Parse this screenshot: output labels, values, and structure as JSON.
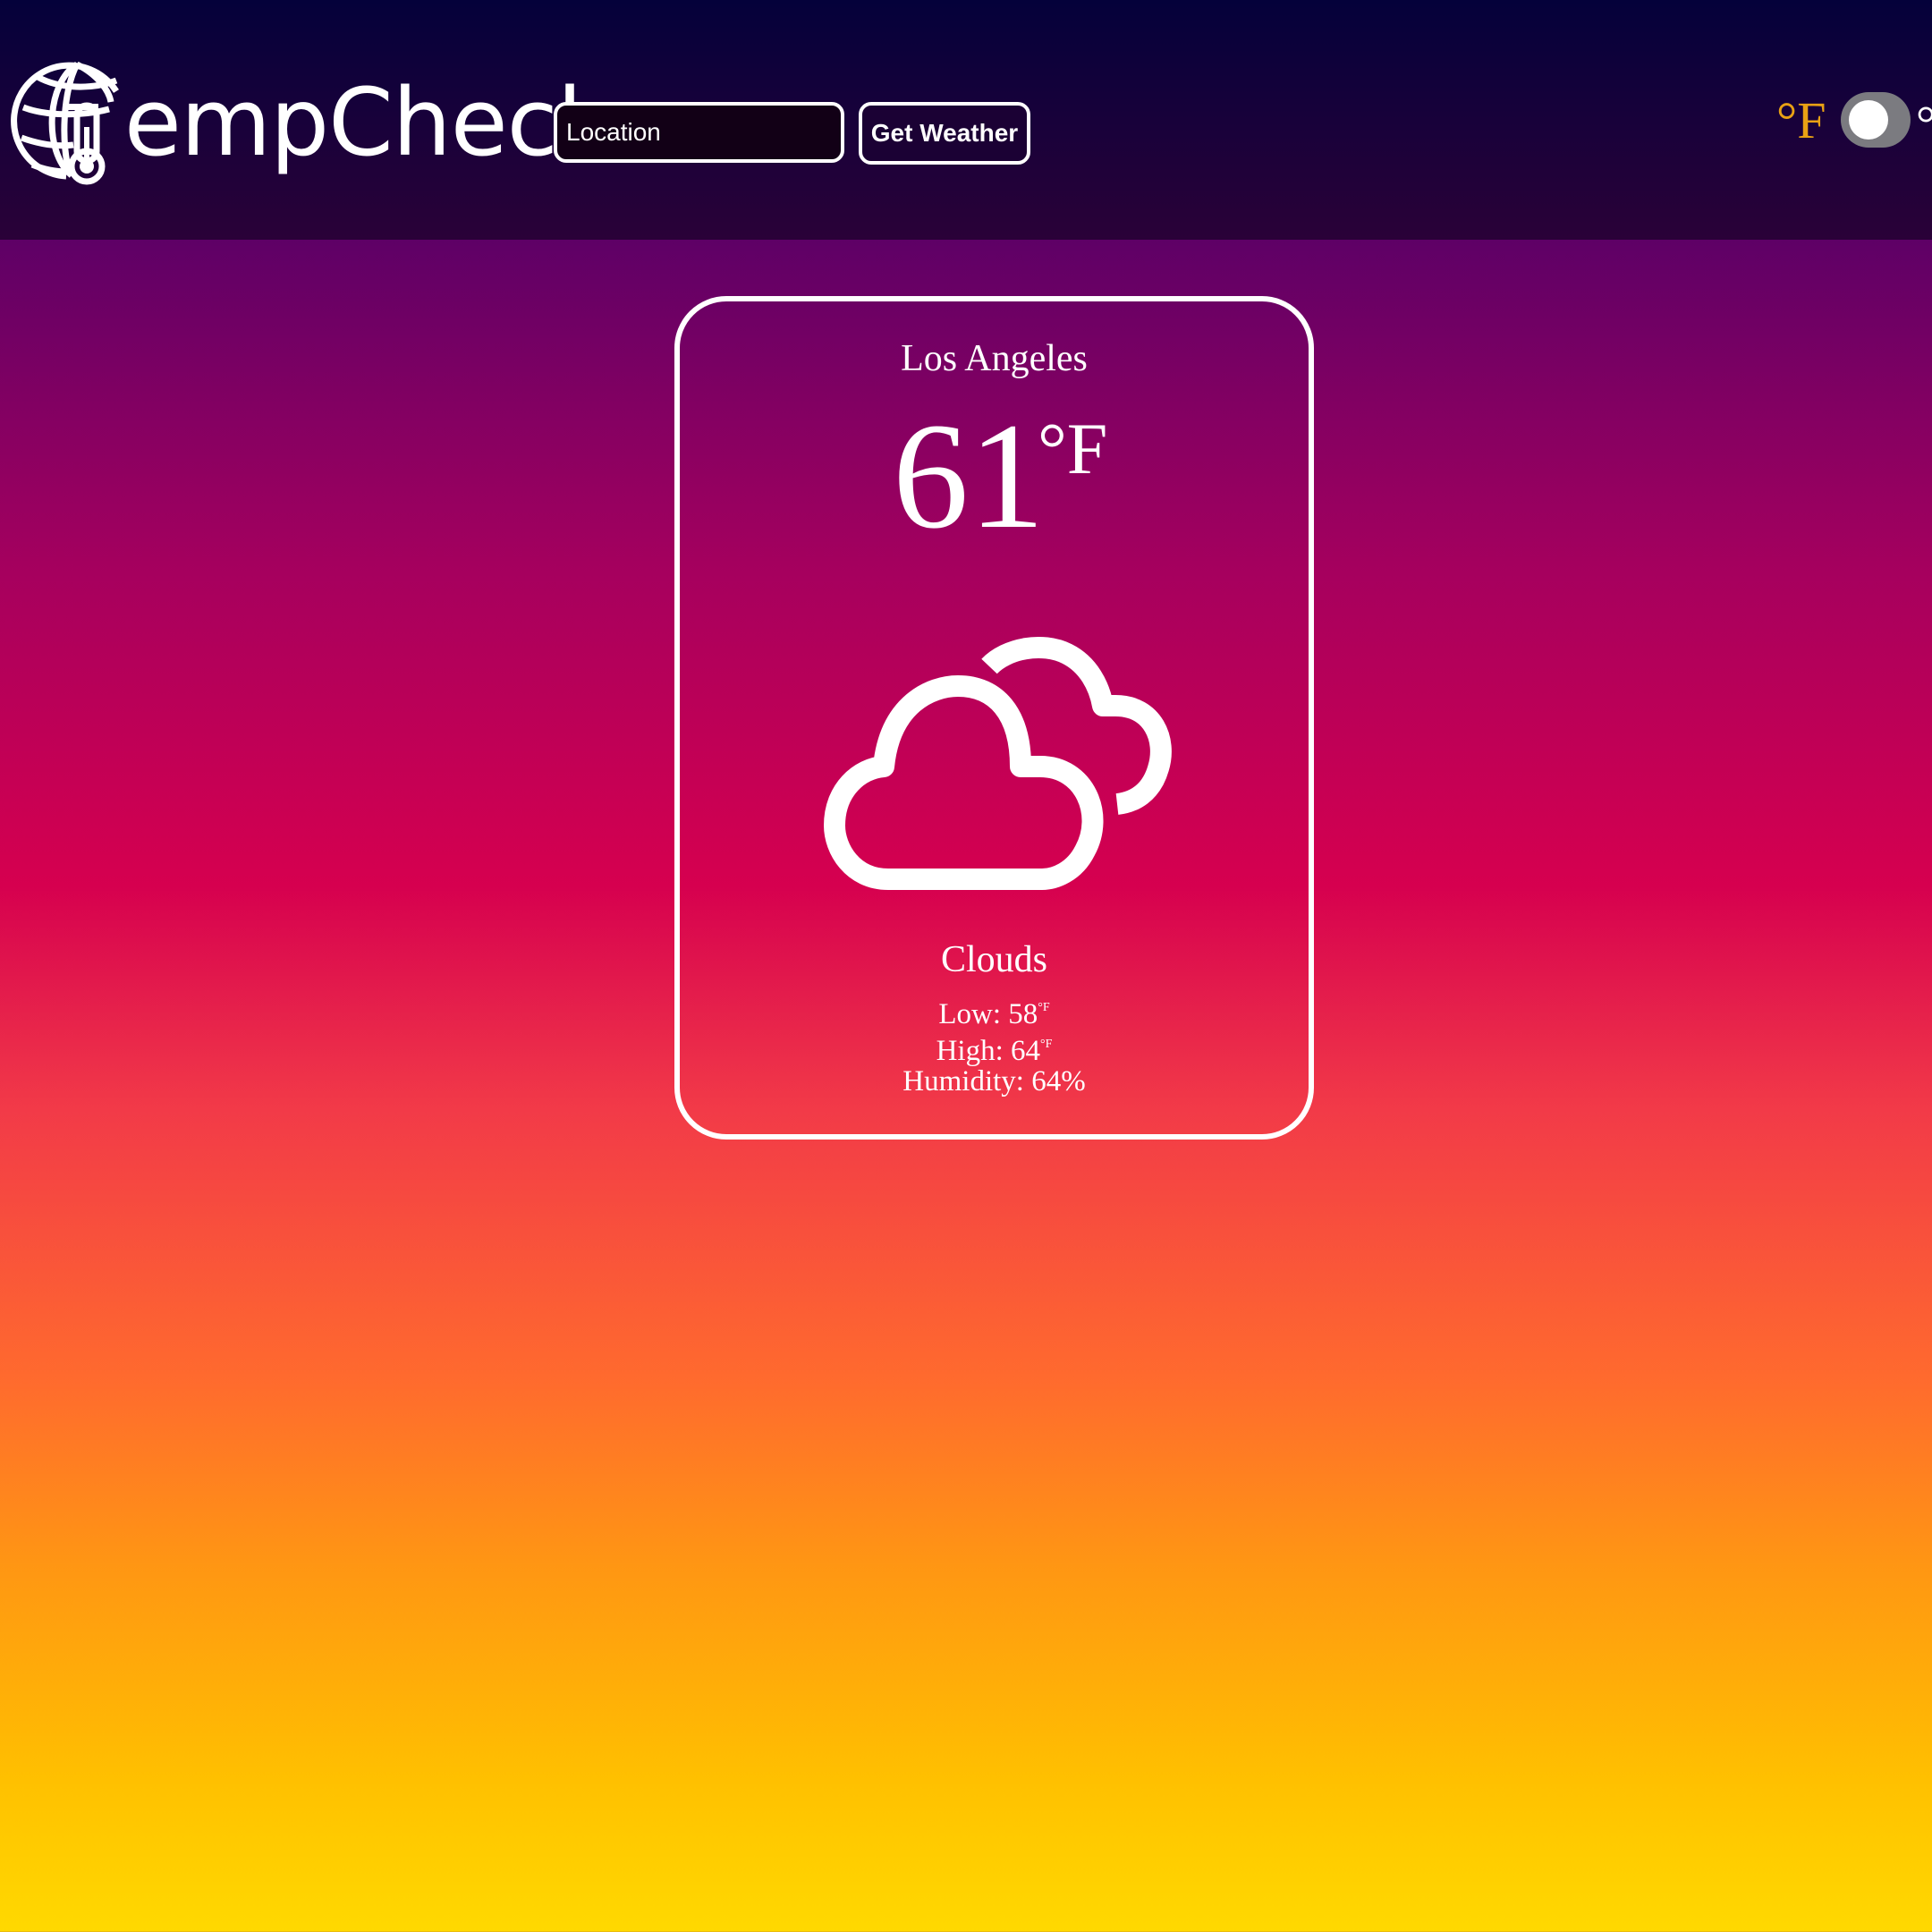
{
  "header": {
    "logo_text_first": "T",
    "logo_text_rest": "empCheck",
    "search": {
      "placeholder": "Location",
      "value": ""
    },
    "get_weather_label": "Get Weather",
    "unit_toggle": {
      "fahrenheit_label": "°F",
      "celsius_label": "°C",
      "selected": "F"
    }
  },
  "weather": {
    "city": "Los Angeles",
    "temperature": "61",
    "temperature_unit": "°F",
    "icon": "cloud-icon",
    "condition": "Clouds",
    "low_label": "Low: ",
    "low_value": "58",
    "high_label": "High: ",
    "high_value": "64",
    "stat_unit": "°F",
    "humidity_label": "Humidity: ",
    "humidity_value": "64%"
  },
  "colors": {
    "header_top": "#04013a",
    "header_bottom": "#2a0138",
    "fahrenheit_accent": "#e8a114",
    "toggle_track": "#7b7b80",
    "gradient": [
      "#5e0066",
      "#a6005e",
      "#d6004f",
      "#f23a48",
      "#ff6a2e",
      "#ff9812",
      "#ffc000",
      "#ffd900"
    ]
  }
}
